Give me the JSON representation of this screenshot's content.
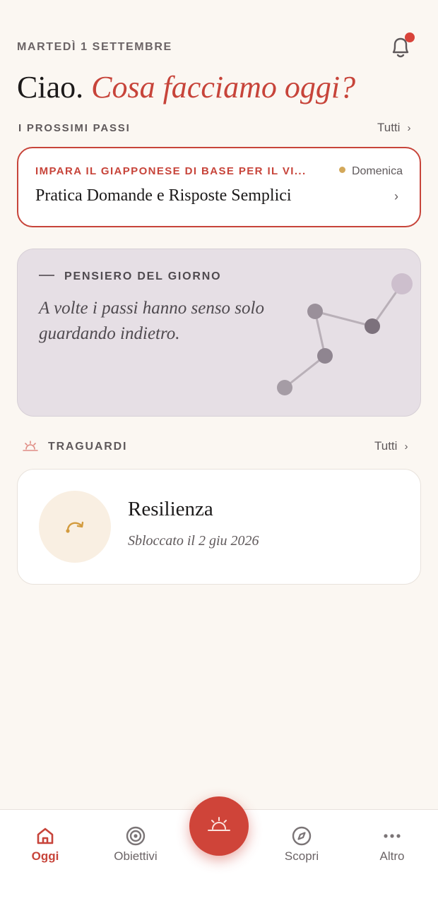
{
  "header": {
    "date": "MARTEDÌ 1 SETTEMBRE",
    "greeting_plain": "Ciao.",
    "greeting_accent": "Cosa facciamo oggi?",
    "notification_badge_color": "#d8433a"
  },
  "next_steps": {
    "label": "I PROSSIMI PASSI",
    "see_all": "Tutti",
    "card": {
      "goal": "IMPARA IL GIAPPONESE DI BASE PER IL VI...",
      "when": "Domenica",
      "task": "Pratica Domande e Risposte Semplici"
    }
  },
  "thought": {
    "label": "PENSIERO DEL GIORNO",
    "quote_line1": "A volte i passi hanno senso solo",
    "quote_line2": "guardando indietro."
  },
  "achievements": {
    "label": "TRAGUARDI",
    "see_all": "Tutti",
    "card": {
      "title": "Resilienza",
      "subtitle": "Sbloccato il 2 giu 2026",
      "icon": "curved-arrow-icon"
    }
  },
  "nav": {
    "items": [
      {
        "label": "Oggi",
        "icon": "home-icon",
        "active": true
      },
      {
        "label": "Obiettivi",
        "icon": "target-icon",
        "active": false
      },
      {
        "label": "Scopri",
        "icon": "compass-icon",
        "active": false
      },
      {
        "label": "Altro",
        "icon": "more-icon",
        "active": false
      }
    ],
    "fab_icon": "sunrise-icon"
  },
  "colors": {
    "accent": "#c7443a",
    "background": "#fbf7f2",
    "thought_card": "#e6dfe5",
    "badge_bg": "#f9efe2",
    "dot_gold": "#d3a85a"
  }
}
